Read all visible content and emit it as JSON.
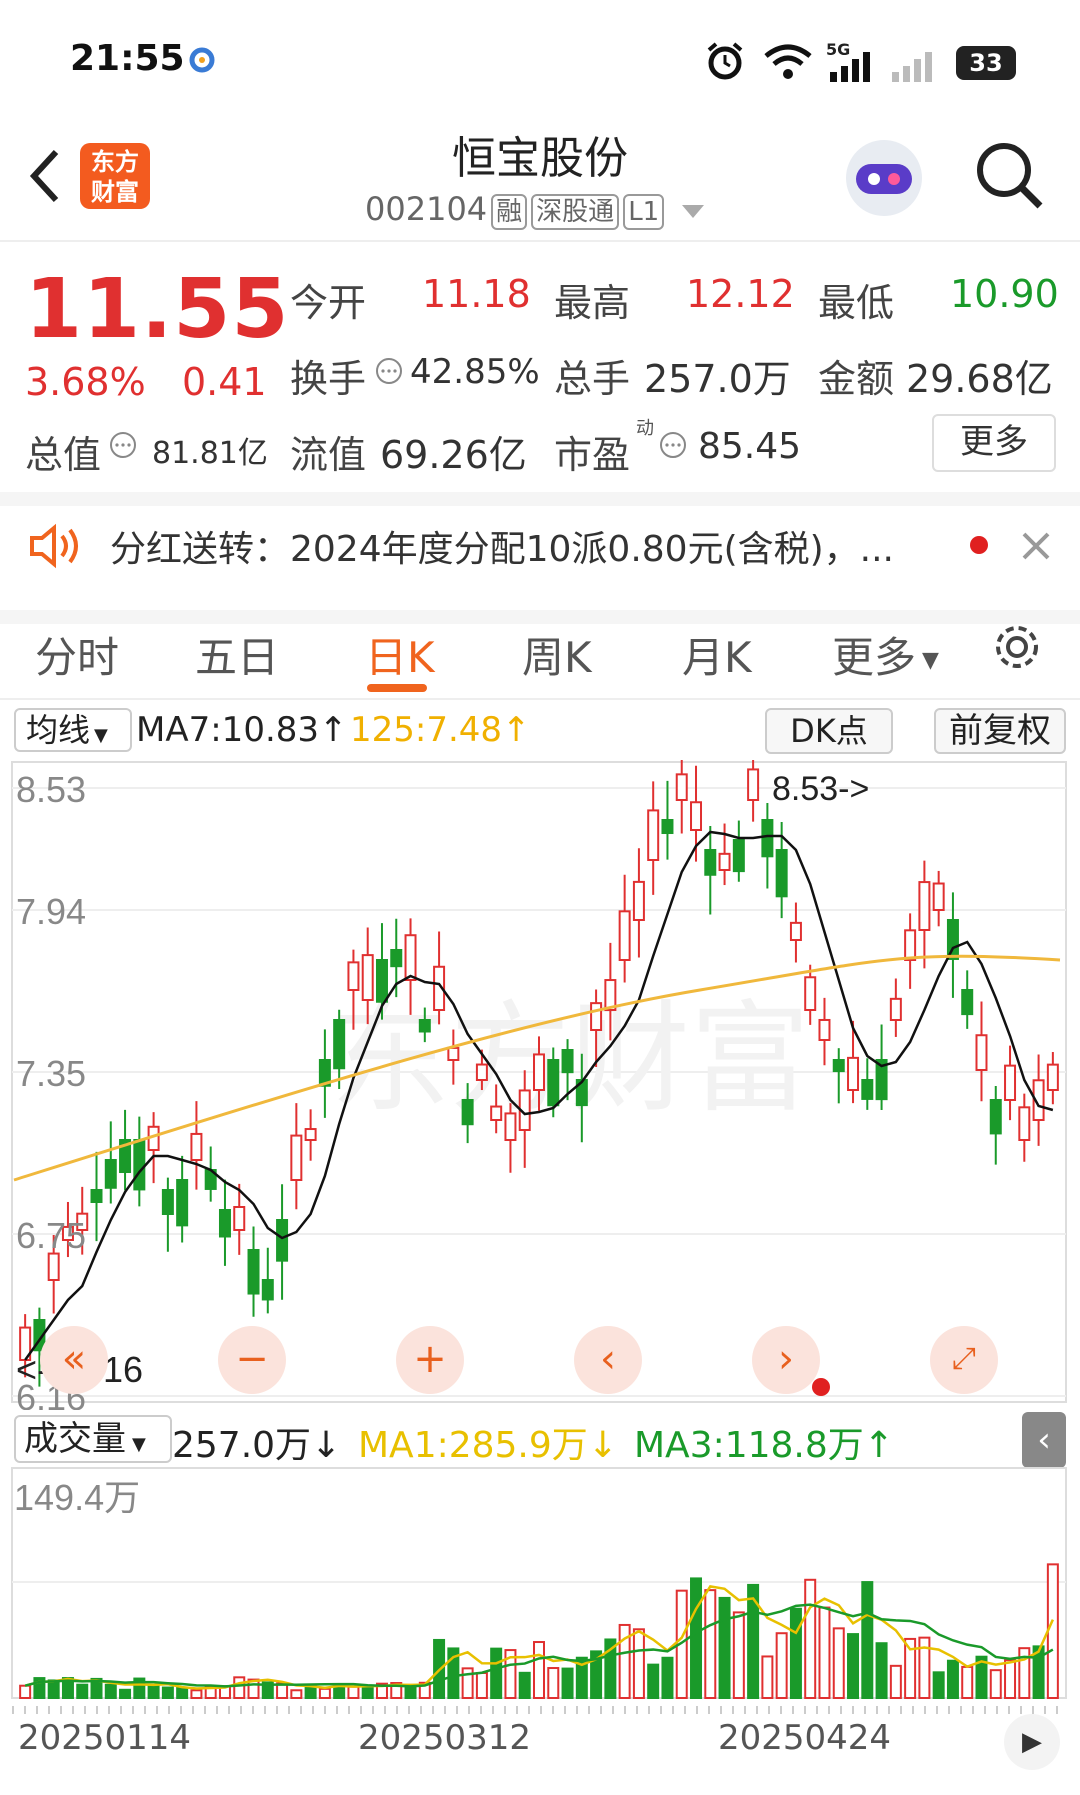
{
  "status_bar": {
    "time": "21:55",
    "network": "5G",
    "battery": "33"
  },
  "header": {
    "back_icon": "chevron-left-icon",
    "logo_line1": "东方",
    "logo_line2": "财富",
    "stock_name": "恒宝股份",
    "stock_code": "002104",
    "tags": [
      "融",
      "深股通",
      "L1"
    ]
  },
  "quote": {
    "price": "11.55",
    "change_pct": "3.68%",
    "change_amt": "0.41",
    "open_label": "今开",
    "open": "11.18",
    "high_label": "最高",
    "high": "12.12",
    "low_label": "最低",
    "low": "10.90",
    "turnover_label": "换手",
    "turnover": "42.85%",
    "volume_label": "总手",
    "volume": "257.0万",
    "amount_label": "金额",
    "amount": "29.68亿",
    "mktcap_label": "总值",
    "mktcap": "81.81亿",
    "float_label": "流值",
    "float_cap": "69.26亿",
    "pe_label": "市盈",
    "pe_sup": "动",
    "pe": "85.45",
    "more": "更多"
  },
  "notice": {
    "text": "分红送转：2024年度分配10派0.80元(含税)，..."
  },
  "tabs": [
    "分时",
    "五日",
    "日K",
    "周K",
    "月K",
    "更多"
  ],
  "active_tab": 2,
  "kline": {
    "ma_dropdown": "均线",
    "ma7": "MA7:10.83↑",
    "ma125": "125:7.48↑",
    "dk_button": "DK点",
    "adjust_button": "前复权",
    "y_labels": [
      "8.53",
      "7.94",
      "7.35",
      "6.75",
      "6.16"
    ],
    "max_marker": "8.53->",
    "min_marker": "<---6.16",
    "watermark": "东方财富"
  },
  "volume": {
    "dropdown": "成交量",
    "value": "257.0万↓",
    "ma1": "MA1:285.9万↓",
    "ma3": "MA3:118.8万↑",
    "max_label": "149.4万"
  },
  "dates": [
    "20250114",
    "20250312",
    "20250424"
  ],
  "colors": {
    "up": "#e03030",
    "down": "#1a9a2a",
    "accent": "#f0641e",
    "ma_short": "#111111",
    "ma_long": "#f0b83c"
  }
}
